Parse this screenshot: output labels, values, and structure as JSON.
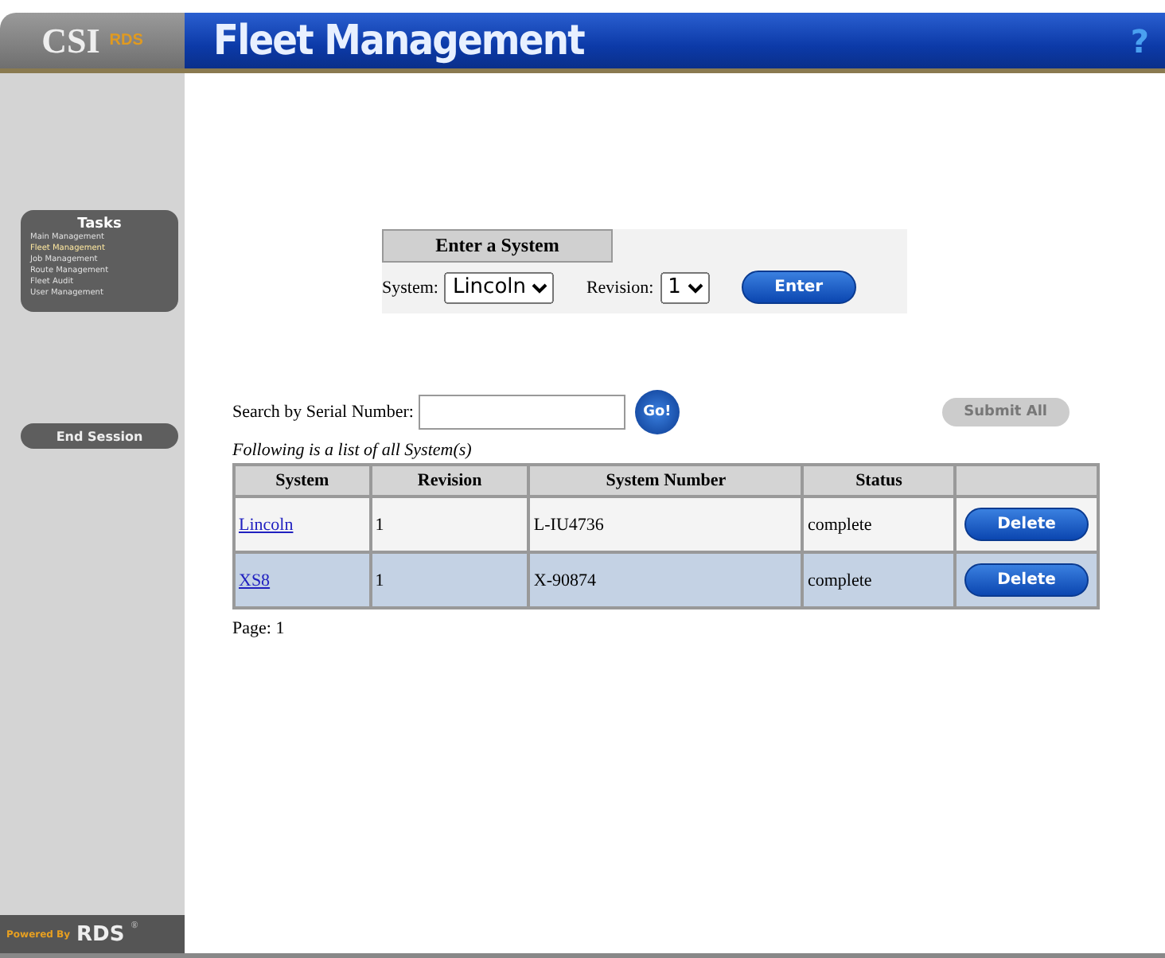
{
  "header": {
    "logo": "CSI",
    "logo_suffix": "RDS",
    "title": "Fleet Management",
    "help": "?"
  },
  "sidebar": {
    "tasks_title": "Tasks",
    "tasks": [
      {
        "label": "Main Management",
        "selected": false
      },
      {
        "label": "Fleet Management",
        "selected": true
      },
      {
        "label": "Job Management",
        "selected": false
      },
      {
        "label": "Route Management",
        "selected": false
      },
      {
        "label": "Fleet Audit",
        "selected": false
      },
      {
        "label": "User Management",
        "selected": false
      }
    ],
    "end_session": "End Session",
    "powered_by": "Powered By",
    "brand": "RDS",
    "brand_mark": "®"
  },
  "enter_system": {
    "title": "Enter a System",
    "system_label": "System:",
    "system_value": "Lincoln",
    "revision_label": "Revision:",
    "revision_value": "1",
    "enter_button": "Enter"
  },
  "search": {
    "label": "Search by Serial Number:",
    "go_button": "Go!",
    "submit_button": {
      "label": "Submit All",
      "disabled": true
    }
  },
  "list_caption": "Following is a list of all System(s)",
  "table": {
    "columns": [
      "System",
      "Revision",
      "System Number",
      "Status"
    ],
    "rows": [
      {
        "system": "Lincoln",
        "revision": "1",
        "number": "L-IU4736",
        "status": "complete",
        "action": "Delete"
      },
      {
        "system": "XS8",
        "revision": "1",
        "number": "X-90874",
        "status": "complete",
        "action": "Delete"
      }
    ]
  },
  "page": "Page: 1"
}
